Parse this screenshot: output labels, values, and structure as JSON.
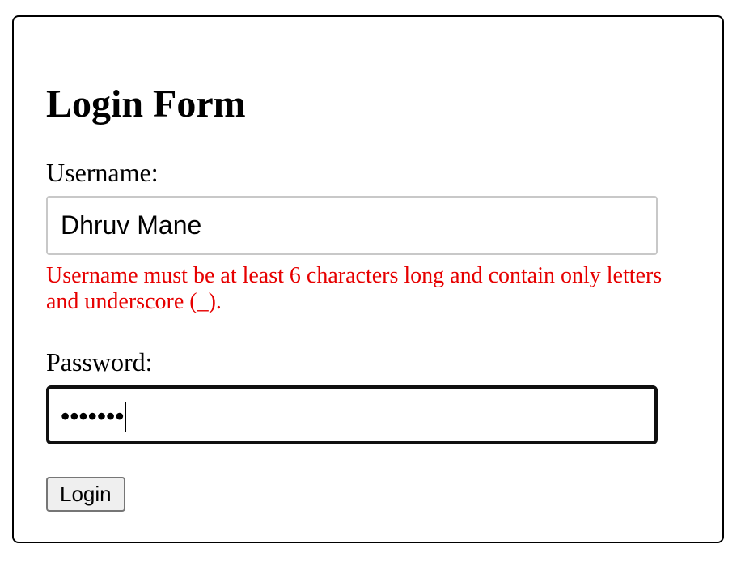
{
  "form": {
    "title": "Login Form",
    "username": {
      "label": "Username:",
      "value": "Dhruv Mane",
      "error": "Username must be at least 6 characters long and contain only letters and underscore (_)."
    },
    "password": {
      "label": "Password:",
      "masked_value": "•••••••"
    },
    "login_button": {
      "label": "Login"
    }
  },
  "colors": {
    "error": "#e60000",
    "focused_border": "#101010",
    "input_border": "#c8c8c8",
    "button_bg": "#efefef"
  }
}
